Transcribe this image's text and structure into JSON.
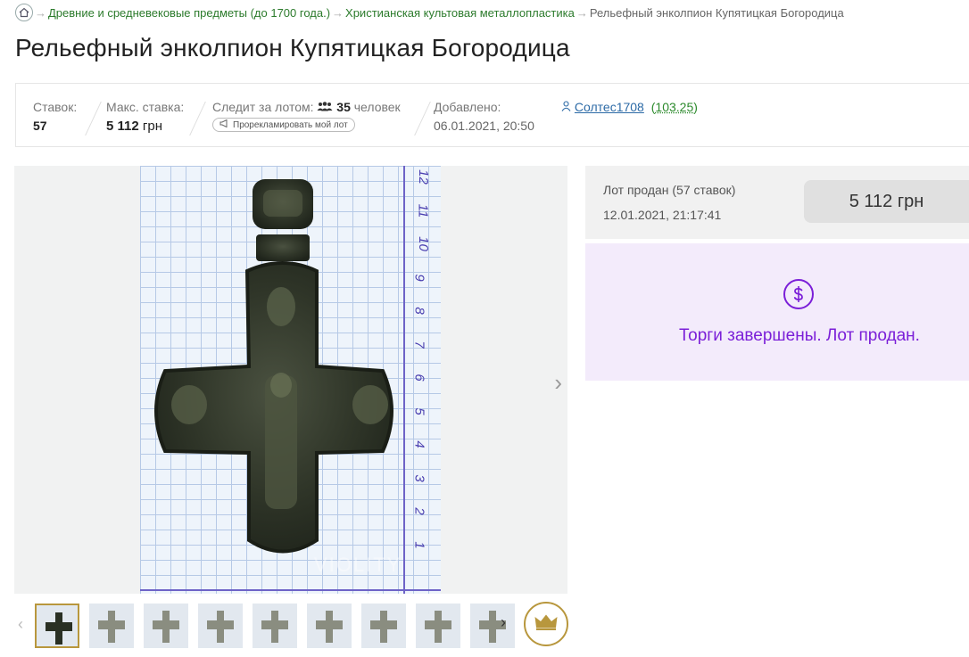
{
  "breadcrumb": {
    "items": [
      "Древние и средневековые предметы (до 1700 года.)",
      "Христианская культовая металлопластика"
    ],
    "current": "Рельефный энколпион Купятицкая Богородица",
    "separator": "→"
  },
  "page": {
    "title": "Рельефный энколпион Купятицкая Богородица"
  },
  "stats": {
    "bids_label": "Ставок:",
    "bids_value": "57",
    "max_bid_label": "Макс. ставка:",
    "max_bid_amount": "5 112",
    "max_bid_currency": "грн",
    "watchers_label": "Следит за лотом:",
    "watchers_count": "35",
    "watchers_unit": "человек",
    "promo_label": "Прорекламировать мой лот",
    "added_label": "Добавлено:",
    "added_value": "06.01.2021, 20:50",
    "seller_name": "Солтес1708",
    "seller_rating": "103.25"
  },
  "gallery": {
    "watermark": "VIOLITY",
    "ruler_numbers": [
      "12",
      "11",
      "10",
      "9",
      "8",
      "7",
      "6",
      "5",
      "4",
      "3",
      "2",
      "1"
    ],
    "thumbnail_count": 9,
    "active_thumbnail": 1
  },
  "result": {
    "sold_label": "Лот продан (57 ставок)",
    "sold_date": "12.01.2021, 21:17:41",
    "sold_price": "5 112 грн",
    "ended_message": "Торги завершены. Лот продан."
  },
  "colors": {
    "link_green": "#2c7b2c",
    "accent_purple": "#7b1fd8",
    "gold": "#b8973d"
  }
}
